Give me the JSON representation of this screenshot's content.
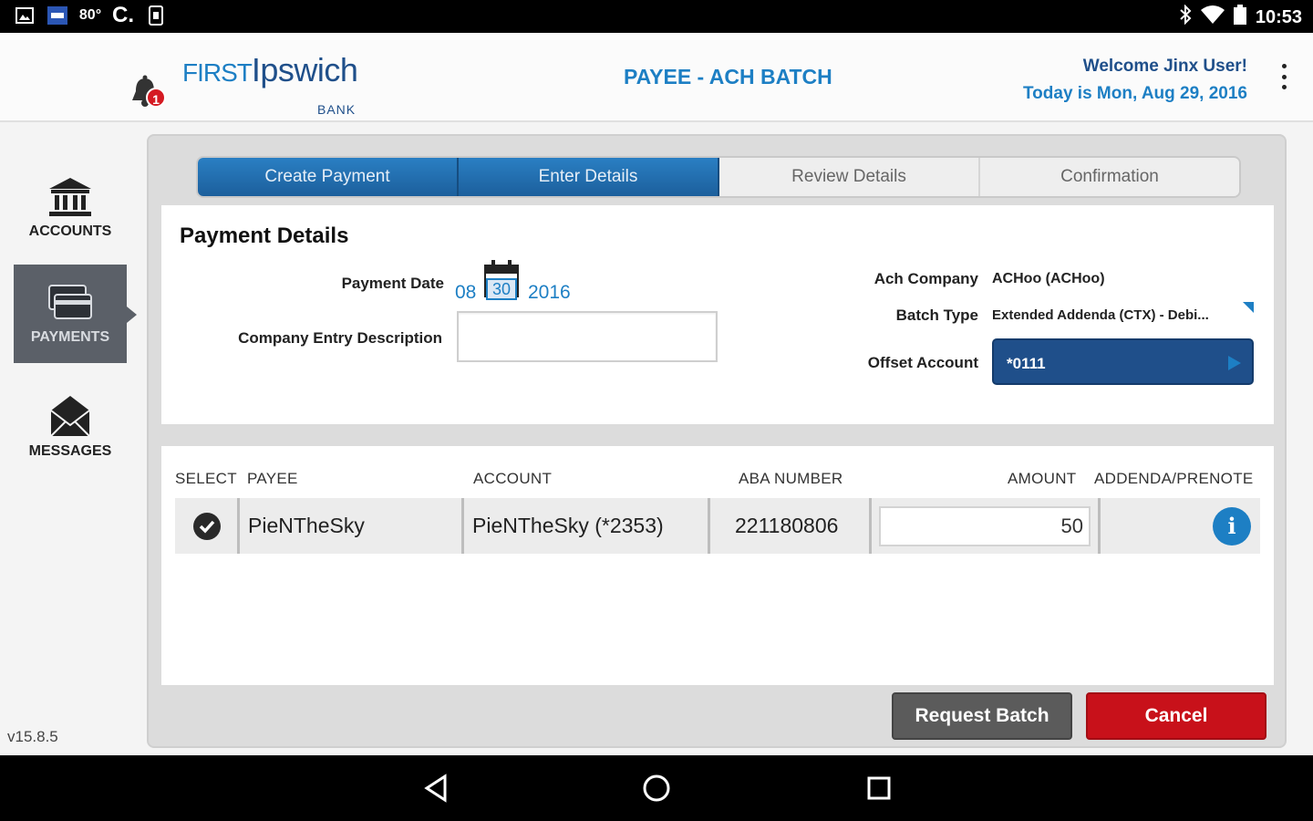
{
  "status_bar": {
    "time": "10:53",
    "left_icons": [
      "image-icon",
      "bank-notification-icon",
      "weather-icon",
      "c-icon",
      "sim-icon"
    ],
    "weather_text": "80°",
    "right_icons": [
      "bluetooth-icon",
      "wifi-icon",
      "battery-icon"
    ]
  },
  "header": {
    "logo_first": "FIRST",
    "logo_ipswich": "Ipswich",
    "logo_bank": "BANK",
    "title": "PAYEE - ACH BATCH",
    "welcome": "Welcome Jinx User!",
    "today": "Today is Mon, Aug 29, 2016",
    "notification_count": "1"
  },
  "sidebar": {
    "items": [
      {
        "label": "ACCOUNTS",
        "icon": "bank-icon",
        "active": false
      },
      {
        "label": "PAYMENTS",
        "icon": "cards-icon",
        "active": true
      },
      {
        "label": "MESSAGES",
        "icon": "envelope-icon",
        "active": false
      }
    ],
    "version": "v15.8.5"
  },
  "steps": [
    {
      "label": "Create Payment",
      "done": true
    },
    {
      "label": "Enter Details",
      "done": true
    },
    {
      "label": "Review Details",
      "done": false
    },
    {
      "label": "Confirmation",
      "done": false
    }
  ],
  "payment_details": {
    "title": "Payment Details",
    "payment_date_label": "Payment Date",
    "date_month": "08",
    "date_day": "30",
    "date_year": "2016",
    "entry_desc_label": "Company Entry Description",
    "entry_desc_value": "",
    "ach_company_label": "Ach Company",
    "ach_company_value": "ACHoo (ACHoo)",
    "batch_type_label": "Batch Type",
    "batch_type_value": "Extended Addenda (CTX) - Debi...",
    "offset_account_label": "Offset Account",
    "offset_account_value": "*0111"
  },
  "payees_table": {
    "columns": [
      "SELECT",
      "PAYEE",
      "ACCOUNT",
      "ABA NUMBER",
      "AMOUNT",
      "ADDENDA/PRENOTE"
    ],
    "rows": [
      {
        "selected": true,
        "payee": "PieNTheSky",
        "account": "PieNTheSky (*2353)",
        "aba": "221180806",
        "amount": "50",
        "addenda_icon": "info-icon"
      }
    ]
  },
  "actions": {
    "request_batch": "Request Batch",
    "cancel": "Cancel"
  },
  "colors": {
    "brand_blue": "#1d7fc4",
    "navy": "#1f4f8a",
    "cancel_red": "#c8111a",
    "request_gray": "#5b5b5b"
  }
}
